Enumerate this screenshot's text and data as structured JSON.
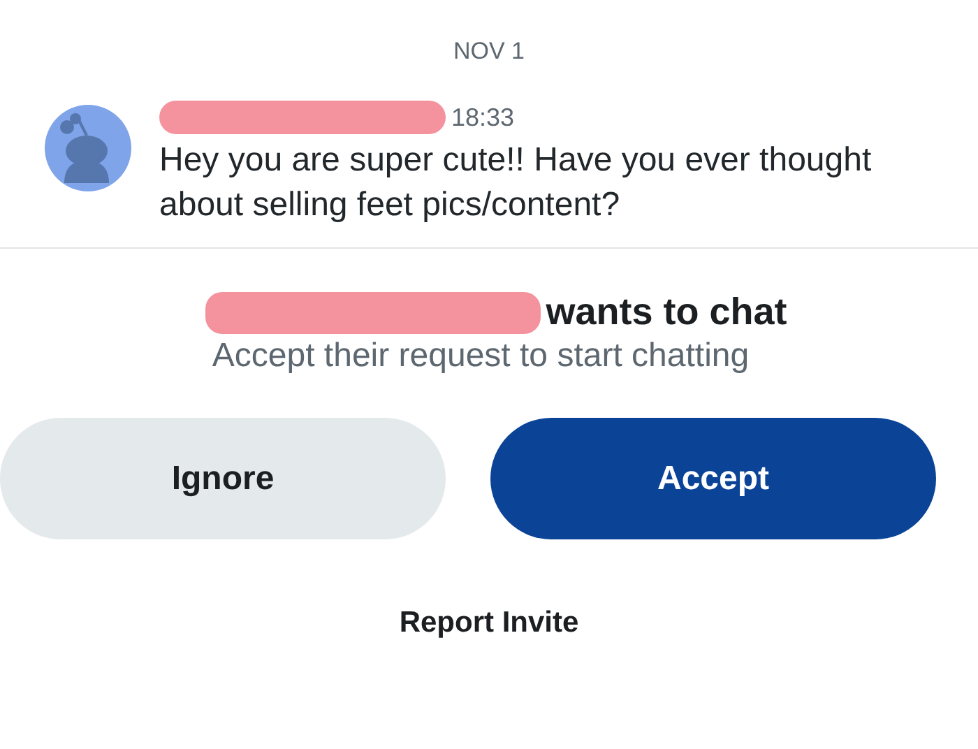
{
  "date_divider": "NOV 1",
  "message": {
    "time": "18:33",
    "text": "Hey you are super cute!! Have you ever thought about selling feet pics/content?"
  },
  "chat_request": {
    "title": "wants to chat",
    "subtitle": "Accept their request to start chatting"
  },
  "buttons": [
    {
      "label": "Ignore",
      "kind": "secondary"
    },
    {
      "label": "Accept",
      "kind": "primary"
    }
  ],
  "report_link": "Report Invite"
}
